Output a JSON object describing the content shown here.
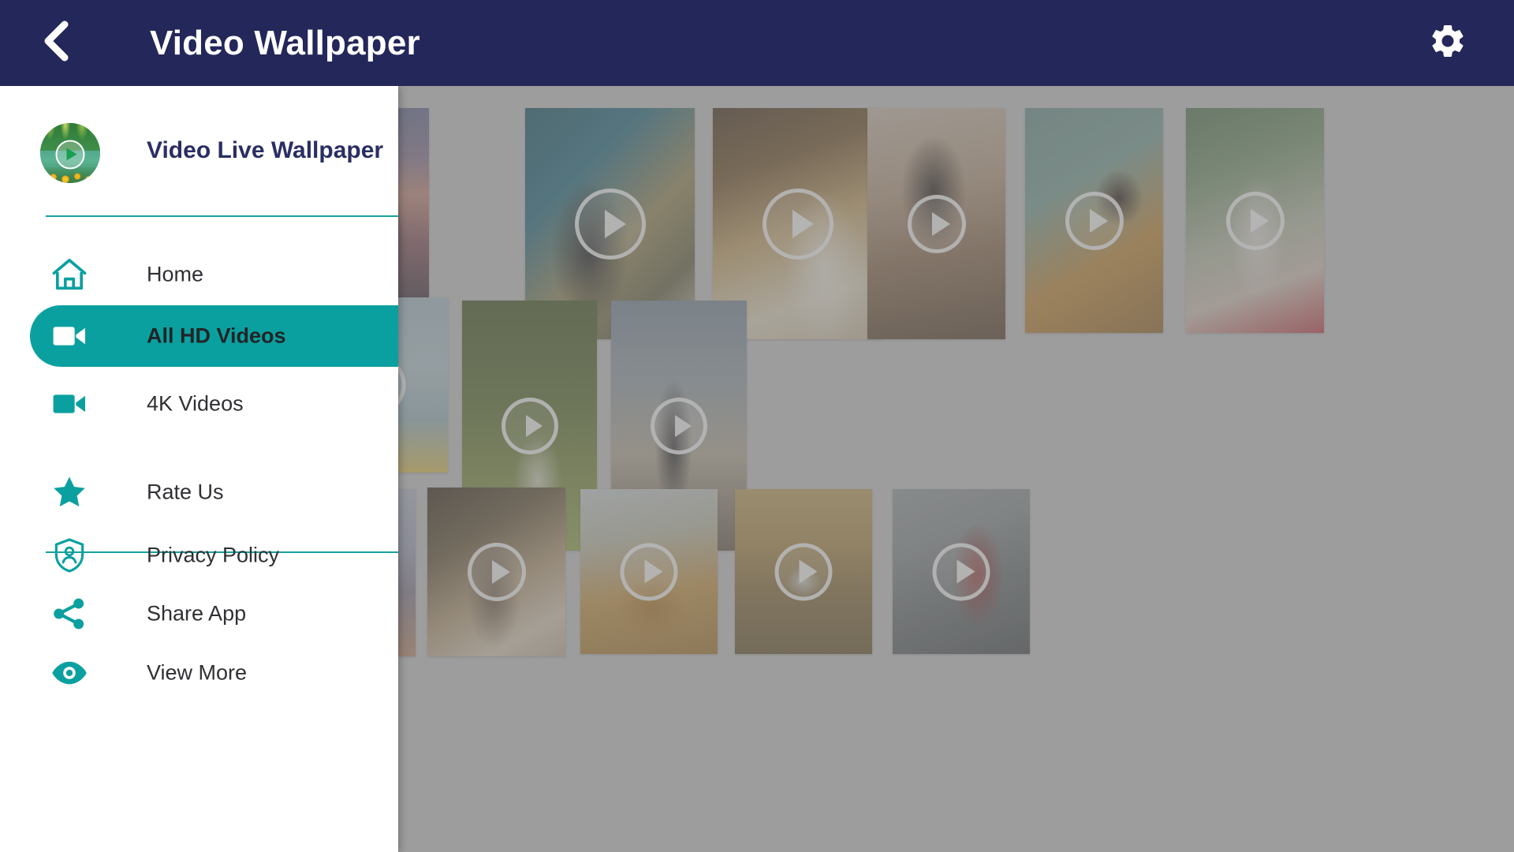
{
  "header": {
    "title": "Video Wallpaper",
    "back_icon": "chevron-left-icon",
    "settings_icon": "gear-icon",
    "bg_color": "#232759",
    "text_color": "#ffffff"
  },
  "drawer": {
    "app_name": "Video Live Wallpaper",
    "logo_icon": "app-logo-play-icon",
    "accent_color": "#0ba0a0",
    "divider_color": "#17a2a2",
    "background": "#ffffff",
    "items": [
      {
        "label": "Home",
        "icon": "home-icon",
        "active": false
      },
      {
        "label": "All HD Videos",
        "icon": "video-camera-icon",
        "active": true
      },
      {
        "label": "4K Videos",
        "icon": "video-camera-icon",
        "active": false
      },
      {
        "label": "Rate Us",
        "icon": "star-icon",
        "active": false
      },
      {
        "label": "Privacy Policy",
        "icon": "shield-user-icon",
        "active": false
      },
      {
        "label": "Share App",
        "icon": "share-icon",
        "active": false
      },
      {
        "label": "View More",
        "icon": "eye-icon",
        "active": false
      }
    ]
  },
  "content": {
    "background_color": "#c9c9c9",
    "scrim_color": "rgba(120,120,120,0.55)",
    "play_overlay_icon": "play-circle-icon",
    "thumbnails": [
      {
        "name": "woman-sunset-rooftop",
        "row": 1
      },
      {
        "name": "couple-winter-snow",
        "row": 1
      },
      {
        "name": "bride-wedding-dress",
        "row": 1
      },
      {
        "name": "graduate-confetti",
        "row": 1
      },
      {
        "name": "butterfly-orange-flower",
        "row": 1
      },
      {
        "name": "woman-sunglasses-street",
        "row": 1
      },
      {
        "name": "dog-pool-float",
        "row": 2
      },
      {
        "name": "child-balloons-park",
        "row": 2
      },
      {
        "name": "person-sunset-silhouette",
        "row": 2
      },
      {
        "name": "woman-cap-beach",
        "row": 3
      },
      {
        "name": "woman-mirror-sunlight",
        "row": 3
      },
      {
        "name": "pancakes-food",
        "row": 3
      },
      {
        "name": "car-desert-dust",
        "row": 3
      },
      {
        "name": "spiderman-cosplay",
        "row": 3
      }
    ]
  }
}
